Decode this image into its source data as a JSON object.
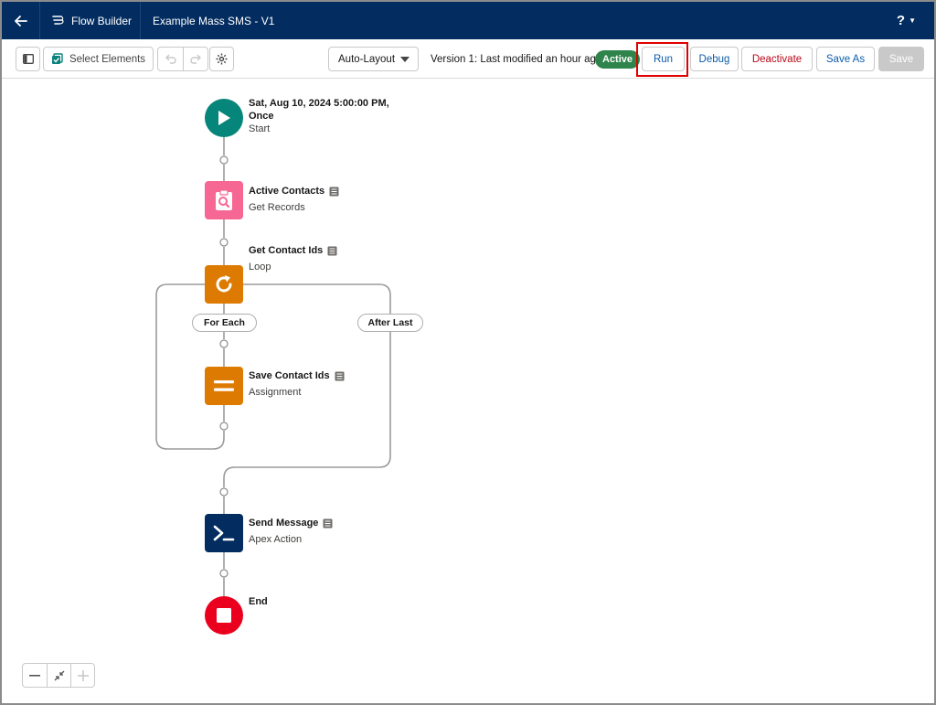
{
  "header": {
    "app_label": "Flow Builder",
    "flow_title": "Example Mass SMS - V1",
    "help_label": "?"
  },
  "toolbar": {
    "select_elements_label": "Select Elements",
    "layout_select_value": "Auto-Layout",
    "version_text": "Version 1: Last modified an hour ago",
    "status_badge": "Active",
    "run_label": "Run",
    "debug_label": "Debug",
    "deactivate_label": "Deactivate",
    "save_as_label": "Save As",
    "save_label": "Save"
  },
  "flow": {
    "start": {
      "title_line1": "Sat, Aug 10, 2024 5:00:00 PM,",
      "title_line2": "Once",
      "type": "Start",
      "color": "#06857a",
      "icon": "play-icon"
    },
    "get_records": {
      "title": "Active Contacts",
      "type": "Get Records",
      "color": "#f66794",
      "icon": "clipboard-search-icon"
    },
    "loop": {
      "title": "Get Contact Ids",
      "type": "Loop",
      "color": "#dd7a01",
      "icon": "loop-icon"
    },
    "for_each_label": "For Each",
    "after_last_label": "After Last",
    "assignment": {
      "title": "Save Contact Ids",
      "type": "Assignment",
      "color": "#dd7a01",
      "icon": "equals-icon"
    },
    "apex_action": {
      "title": "Send Message",
      "type": "Apex Action",
      "color": "#032d60",
      "icon": "terminal-icon"
    },
    "end": {
      "title": "End",
      "color": "#ea001e",
      "icon": "stop-icon"
    }
  },
  "colors": {
    "header_bg": "#032d60",
    "accent_blue": "#0b5cab",
    "active_green": "#2e844a",
    "highlight_red": "#e00000"
  }
}
